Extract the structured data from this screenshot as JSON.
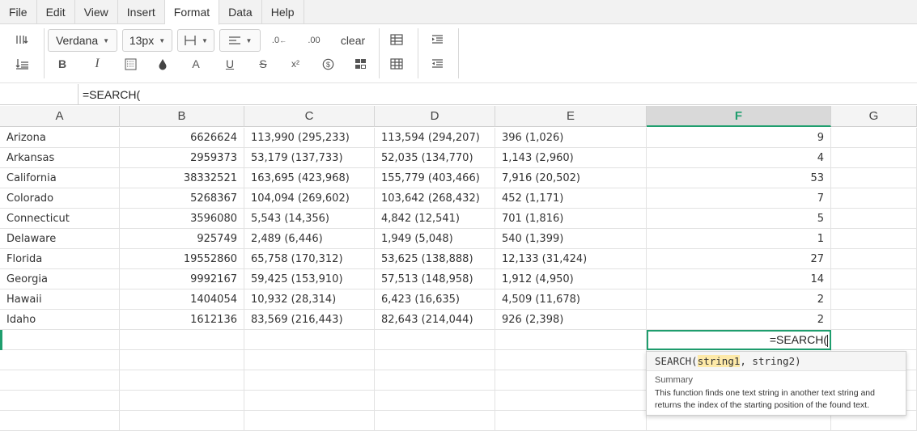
{
  "menu": [
    "File",
    "Edit",
    "View",
    "Insert",
    "Format",
    "Data",
    "Help"
  ],
  "menu_active": "Format",
  "toolbar": {
    "font_family": "Verdana",
    "font_size": "13px",
    "clear_label": "clear",
    "icons_row1": [
      "wrap-text-icon",
      "borders-icon",
      "align-left-icon",
      "decrease-decimal-icon",
      "increase-decimal-icon",
      "table-icon",
      "indent-increase-icon"
    ],
    "icons_row2": [
      "vertical-align-icon",
      "bold-icon",
      "italic-icon",
      "fill-pattern-icon",
      "fill-color-icon",
      "text-color-icon",
      "underline-icon",
      "strikethrough-icon",
      "superscript-icon",
      "currency-icon",
      "format-cells-icon",
      "table-grid-icon",
      "indent-decrease-icon"
    ],
    "glyphs": {
      "bold": "B",
      "italic": "I",
      "text_color": "A",
      "underline": "U",
      "strike": "S",
      "superscript": "x²",
      "currency": "$",
      "decrease_decimal": ".0",
      "increase_decimal": ".00"
    }
  },
  "formula_bar": {
    "value": "=SEARCH("
  },
  "columns": [
    "A",
    "B",
    "C",
    "D",
    "E",
    "F",
    "G"
  ],
  "selected_column": "F",
  "rows": [
    [
      "Arizona",
      "6626624",
      "113,990 (295,233)",
      "113,594 (294,207)",
      "396 (1,026)",
      "9"
    ],
    [
      "Arkansas",
      "2959373",
      "53,179 (137,733)",
      "52,035 (134,770)",
      "1,143 (2,960)",
      "4"
    ],
    [
      "California",
      "38332521",
      "163,695 (423,968)",
      "155,779 (403,466)",
      "7,916 (20,502)",
      "53"
    ],
    [
      "Colorado",
      "5268367",
      "104,094 (269,602)",
      "103,642 (268,432)",
      "452 (1,171)",
      "7"
    ],
    [
      "Connecticut",
      "3596080",
      "5,543 (14,356)",
      "4,842 (12,541)",
      "701 (1,816)",
      "5"
    ],
    [
      "Delaware",
      "925749",
      "2,489 (6,446)",
      "1,949 (5,048)",
      "540 (1,399)",
      "1"
    ],
    [
      "Florida",
      "19552860",
      "65,758 (170,312)",
      "53,625 (138,888)",
      "12,133 (31,424)",
      "27"
    ],
    [
      "Georgia",
      "9992167",
      "59,425 (153,910)",
      "57,513 (148,958)",
      "1,912 (4,950)",
      "14"
    ],
    [
      "Hawaii",
      "1404054",
      "10,932 (28,314)",
      "6,423 (16,635)",
      "4,509 (11,678)",
      "2"
    ],
    [
      "Idaho",
      "1612136",
      "83,569 (216,443)",
      "82,643 (214,044)",
      "926 (2,398)",
      "2"
    ]
  ],
  "active_cell": {
    "value": "=SEARCH("
  },
  "tooltip": {
    "fn_name": "SEARCH(",
    "arg1": "string1",
    "rest": ", string2)",
    "summary_title": "Summary",
    "summary": "This function finds one text string in another text string and returns the index of the starting position of the found text."
  },
  "colors": {
    "accent": "#1f9e6e",
    "header_bg": "#f4f4f4",
    "menubar_bg": "#f2f2f2"
  }
}
